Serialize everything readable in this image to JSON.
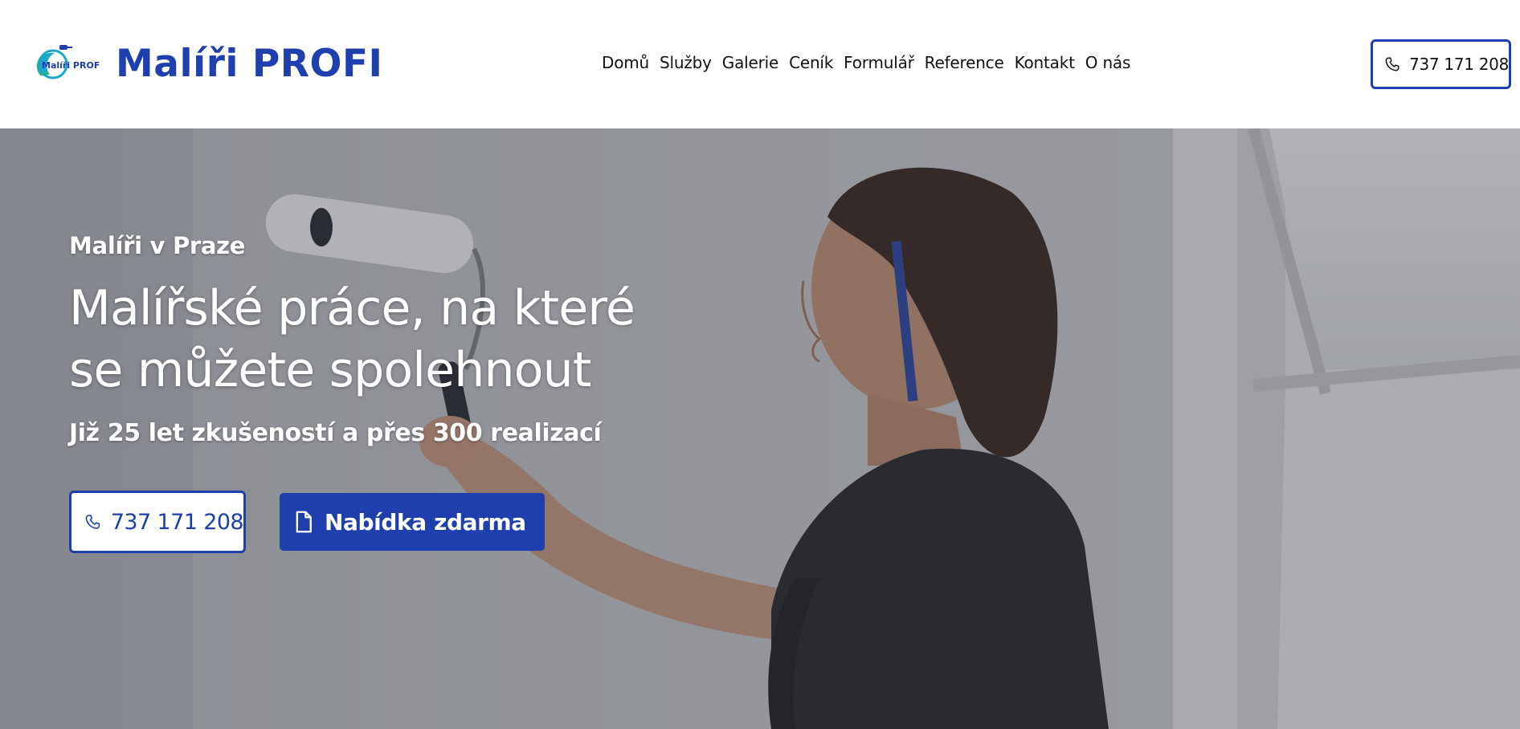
{
  "header": {
    "logo": {
      "icon": "paint-roller-logo-icon",
      "text": "Malíři PROFI",
      "colors": {
        "blue": "#1f3fae",
        "teal": "#1aa7c9",
        "green": "#2bb673"
      }
    },
    "brand": "Malíři PROFI",
    "nav": [
      {
        "label": "Domů"
      },
      {
        "label": "Služby"
      },
      {
        "label": "Galerie"
      },
      {
        "label": "Ceník"
      },
      {
        "label": "Formulář"
      },
      {
        "label": "Reference"
      },
      {
        "label": "Kontakt"
      },
      {
        "label": "O nás"
      }
    ],
    "phone": {
      "icon": "phone-icon",
      "label": "737 171 208"
    }
  },
  "hero": {
    "eyebrow": "Malíři v Praze",
    "headline": [
      "Malířské práce, na které",
      "se můžete spolehnout"
    ],
    "subheadline": "Již 25 let zkušeností a přes 300 realizací",
    "cta_phone": {
      "icon": "phone-icon",
      "label": "737 171 208"
    },
    "cta_offer": {
      "icon": "document-icon",
      "label": "Nabídka zdarma"
    }
  },
  "colors": {
    "accent": "#1f3fae",
    "text_dark": "#111111",
    "hero_text": "#ffffff"
  }
}
